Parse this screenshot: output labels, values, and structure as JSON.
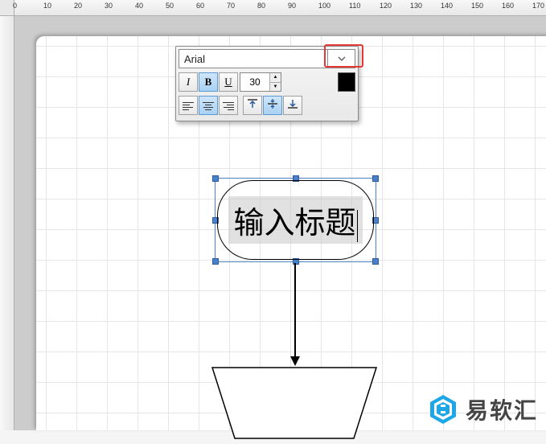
{
  "ruler": {
    "unit_marks": [
      0,
      10,
      20,
      30,
      40,
      50,
      60,
      70,
      80,
      90,
      100,
      110,
      120,
      130,
      140,
      150,
      160,
      170
    ]
  },
  "toolbar": {
    "font_name": "Arial",
    "italic_label": "I",
    "bold_label": "B",
    "underline_label": "U",
    "font_size": "30",
    "color": "#000000"
  },
  "shape": {
    "title_text": "输入标题"
  },
  "watermark": {
    "text": "易软汇",
    "accent": "#1ea7e8"
  }
}
